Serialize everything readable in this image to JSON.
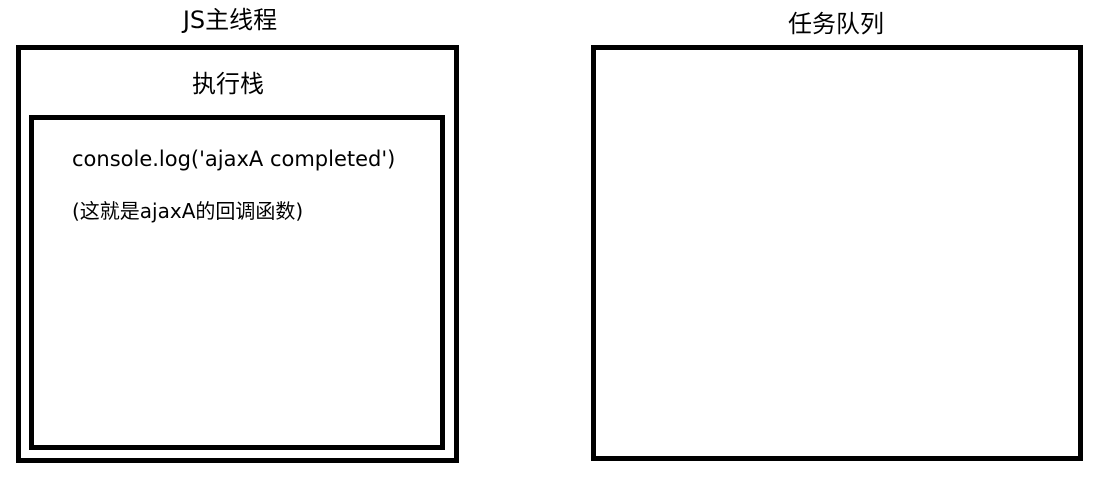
{
  "main_thread": {
    "title": "JS主线程",
    "execution_stack": {
      "title": "执行栈",
      "code_line": "console.log('ajaxA completed')",
      "note": "(这就是ajaxA的回调函数)"
    }
  },
  "task_queue": {
    "title": "任务队列"
  }
}
